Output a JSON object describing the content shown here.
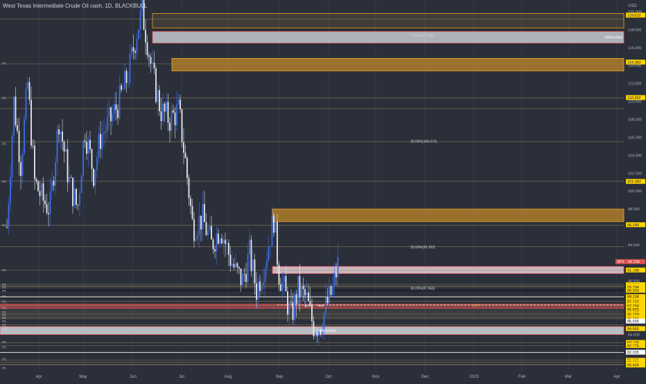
{
  "title": "West Texas Intermediate Crude Oil cash, 1D, BLACKBULL",
  "currency": "USD",
  "colors": {
    "bg": "#2b2f3a",
    "up": "#3d6fe6",
    "down": "#e8eaf0",
    "accent": "#f5a623",
    "resistance": "#e05252",
    "highlight": "#ffd600"
  },
  "chart_data": {
    "type": "candlestick",
    "title": "West Texas Intermediate Crude Oil cash, 1D, BLACKBULL",
    "ylim": [
      79.8,
      121.0
    ],
    "x_tick_labels": [
      "Apr",
      "May",
      "Jun",
      "Jul",
      "Aug",
      "Sep",
      "Oct",
      "Nov",
      "Dec",
      "2023",
      "Feb",
      "Mar",
      "Apr"
    ],
    "y_tick_labels": [
      "120.000",
      "118.000",
      "116.000",
      "114.000",
      "112.000",
      "110.000",
      "108.000",
      "106.000",
      "104.000",
      "102.000",
      "100.000",
      "98.000",
      "94.000",
      "90.000",
      "88.000",
      "84.000",
      "82.000"
    ],
    "price_labels": [
      {
        "value": "119.622",
        "style": "yellow"
      },
      {
        "value": "114.383",
        "style": "yellow"
      },
      {
        "value": "110.432",
        "style": "yellow"
      },
      {
        "value": "101.082",
        "style": "yellow"
      },
      {
        "value": "96.249",
        "style": "yellow"
      },
      {
        "value": "91.198",
        "style": "yellow"
      },
      {
        "value": "89.563",
        "style": "yellow"
      },
      {
        "value": "89.411",
        "style": "yellow"
      },
      {
        "value": "89.294",
        "style": "yellow"
      },
      {
        "value": "88.933",
        "style": "yellow"
      },
      {
        "value": "88.238",
        "style": "yellow"
      },
      {
        "value": "87.722",
        "style": "yellow"
      },
      {
        "value": "87.254",
        "style": "yellow"
      },
      {
        "value": "87.204",
        "style": "yellow"
      },
      {
        "value": "86.825",
        "style": "yellow"
      },
      {
        "value": "86.405",
        "style": "yellow"
      },
      {
        "value": "86.229",
        "style": "yellow"
      },
      {
        "value": "85.889",
        "style": "yellow"
      },
      {
        "value": "85.749",
        "style": "yellow"
      },
      {
        "value": "85.505",
        "style": "white"
      },
      {
        "value": "84.665",
        "style": "yellow"
      },
      {
        "value": "83.126",
        "style": "yellow"
      },
      {
        "value": "82.776",
        "style": "yellow"
      },
      {
        "value": "82.035",
        "style": "white"
      },
      {
        "value": "81.131",
        "style": "yellow"
      },
      {
        "value": "80.921",
        "style": "yellow"
      },
      {
        "value": "80.704",
        "style": "yellow"
      },
      {
        "value": "80.606",
        "style": "yellow"
      }
    ],
    "current_price": {
      "symbol": "WTI",
      "value": "92.135"
    },
    "line_annotations": [
      {
        "text": "5.00%(117.380)"
      },
      {
        "text": "15.00%(105.572)"
      },
      {
        "text": "25.00%(93.763)"
      },
      {
        "text": "30.00%(87.858)"
      }
    ],
    "zone_annotations": [
      {
        "text": "sellsbooked"
      },
      {
        "text": "sellsbooked"
      }
    ],
    "dashed_line_label": "poc",
    "candle_labels": [
      "grish",
      "Sept"
    ],
    "left_level_label": "ITL"
  }
}
